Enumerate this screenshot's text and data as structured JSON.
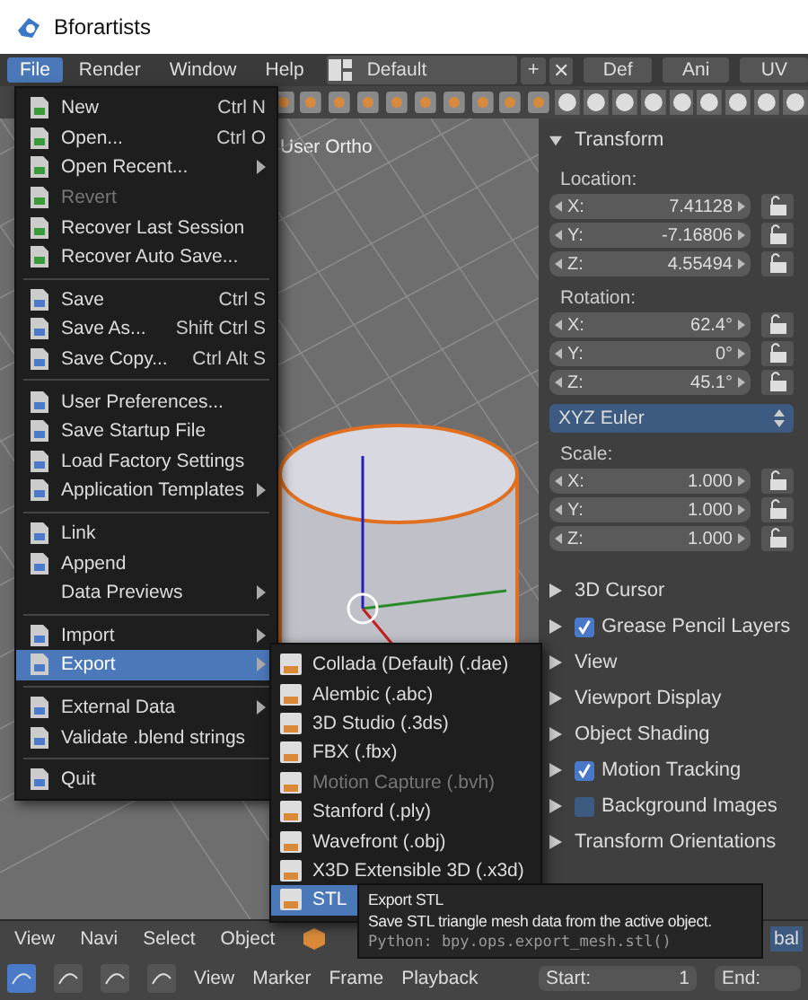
{
  "window": {
    "title": "Bforartists"
  },
  "menubar": {
    "menus": [
      {
        "label": "File",
        "selected": true
      },
      {
        "label": "Render",
        "selected": false
      },
      {
        "label": "Window",
        "selected": false
      },
      {
        "label": "Help",
        "selected": false
      }
    ],
    "layout": "Default",
    "add": "+",
    "close": "✕",
    "tabs": [
      {
        "label": "Def",
        "selected": false
      },
      {
        "label": "Ani",
        "selected": false
      },
      {
        "label": "UV",
        "selected": false
      }
    ]
  },
  "viewport": {
    "label": "User Ortho"
  },
  "file_menu": {
    "groups": [
      [
        {
          "label": "New",
          "shortcut": "Ctrl N",
          "submenu": false,
          "disabled": false,
          "selected": false
        },
        {
          "label": "Open...",
          "shortcut": "Ctrl O",
          "submenu": false,
          "disabled": false,
          "selected": false
        },
        {
          "label": "Open Recent...",
          "submenu": true,
          "disabled": false,
          "selected": false
        },
        {
          "label": "Revert",
          "submenu": false,
          "disabled": true,
          "selected": false
        },
        {
          "label": "Recover Last Session",
          "submenu": false,
          "disabled": false,
          "selected": false
        },
        {
          "label": "Recover Auto Save...",
          "submenu": false,
          "disabled": false,
          "selected": false
        }
      ],
      [
        {
          "label": "Save",
          "shortcut": "Ctrl S",
          "submenu": false,
          "disabled": false,
          "selected": false
        },
        {
          "label": "Save As...",
          "shortcut": "Shift Ctrl S",
          "submenu": false,
          "disabled": false,
          "selected": false
        },
        {
          "label": "Save Copy...",
          "shortcut": "Ctrl Alt S",
          "submenu": false,
          "disabled": false,
          "selected": false
        }
      ],
      [
        {
          "label": "User Preferences...",
          "submenu": false,
          "disabled": false,
          "selected": false
        },
        {
          "label": "Save Startup File",
          "submenu": false,
          "disabled": false,
          "selected": false
        },
        {
          "label": "Load Factory Settings",
          "submenu": false,
          "disabled": false,
          "selected": false
        },
        {
          "label": "Application Templates",
          "submenu": true,
          "disabled": false,
          "selected": false
        }
      ],
      [
        {
          "label": "Link",
          "submenu": false,
          "disabled": false,
          "selected": false
        },
        {
          "label": "Append",
          "submenu": false,
          "disabled": false,
          "selected": false
        },
        {
          "label": "Data Previews",
          "submenu": true,
          "disabled": false,
          "selected": false,
          "no_icon": true
        }
      ],
      [
        {
          "label": "Import",
          "submenu": true,
          "disabled": false,
          "selected": false
        },
        {
          "label": "Export",
          "submenu": true,
          "disabled": false,
          "selected": true
        }
      ],
      [
        {
          "label": "External Data",
          "submenu": true,
          "disabled": false,
          "selected": false
        },
        {
          "label": "Validate .blend strings",
          "submenu": false,
          "disabled": false,
          "selected": false
        }
      ],
      [
        {
          "label": "Quit",
          "submenu": false,
          "disabled": false,
          "selected": false
        }
      ]
    ]
  },
  "export_menu": {
    "items": [
      {
        "label": "Collada (Default) (.dae)",
        "disabled": false,
        "selected": false
      },
      {
        "label": "Alembic (.abc)",
        "disabled": false,
        "selected": false
      },
      {
        "label": "3D Studio (.3ds)",
        "disabled": false,
        "selected": false
      },
      {
        "label": "FBX (.fbx)",
        "disabled": false,
        "selected": false
      },
      {
        "label": "Motion Capture (.bvh)",
        "disabled": true,
        "selected": false
      },
      {
        "label": "Stanford (.ply)",
        "disabled": false,
        "selected": false
      },
      {
        "label": "Wavefront (.obj)",
        "disabled": false,
        "selected": false
      },
      {
        "label": "X3D Extensible 3D (.x3d)",
        "disabled": false,
        "selected": false
      },
      {
        "label": "STL",
        "disabled": false,
        "selected": true
      }
    ]
  },
  "tooltip": {
    "title": "Export STL",
    "description": "Save STL triangle mesh data from the active object.",
    "python": "Python: bpy.ops.export_mesh.stl()"
  },
  "properties": {
    "transform": {
      "title": "Transform",
      "groups": [
        {
          "label": "Location:",
          "fields": [
            {
              "axis": "X:",
              "value": "7.41128"
            },
            {
              "axis": "Y:",
              "value": "-7.16806"
            },
            {
              "axis": "Z:",
              "value": "4.55494"
            }
          ]
        },
        {
          "label": "Rotation:",
          "fields": [
            {
              "axis": "X:",
              "value": "62.4°"
            },
            {
              "axis": "Y:",
              "value": "0°"
            },
            {
              "axis": "Z:",
              "value": "45.1°"
            }
          ],
          "mode": "XYZ Euler"
        },
        {
          "label": "Scale:",
          "fields": [
            {
              "axis": "X:",
              "value": "1.000"
            },
            {
              "axis": "Y:",
              "value": "1.000"
            },
            {
              "axis": "Z:",
              "value": "1.000"
            }
          ]
        }
      ]
    },
    "panels": [
      {
        "title": "3D Cursor",
        "kind": "plain"
      },
      {
        "title": "Grease Pencil Layers",
        "kind": "toggle",
        "checked": true
      },
      {
        "title": "View",
        "kind": "plain"
      },
      {
        "title": "Viewport Display",
        "kind": "plain"
      },
      {
        "title": "Object Shading",
        "kind": "plain"
      },
      {
        "title": "Motion Tracking",
        "kind": "toggle",
        "checked": true
      },
      {
        "title": "Background Images",
        "kind": "toggle",
        "checked": false
      },
      {
        "title": "Transform Orientations",
        "kind": "plain"
      }
    ]
  },
  "view_header": {
    "menus": [
      "View",
      "Navi",
      "Select",
      "Object"
    ],
    "orientation": "bal"
  },
  "timeline": {
    "menus": [
      "View",
      "Marker",
      "Frame",
      "Playback"
    ],
    "start_label": "Start:",
    "start_value": "1",
    "end_label": "End:"
  }
}
